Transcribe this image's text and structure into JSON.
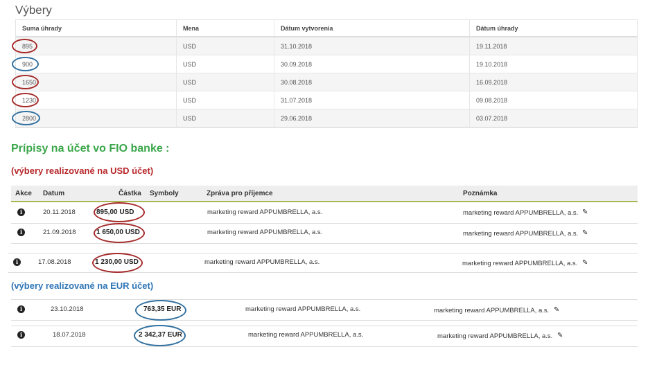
{
  "vybery": {
    "title": "Výbery",
    "headers": [
      "Suma úhrady",
      "Mena",
      "Dátum vytvorenia",
      "Dátum úhrady"
    ],
    "rows": [
      [
        "895",
        "USD",
        "31.10.2018",
        "19.11.2018"
      ],
      [
        "900",
        "USD",
        "30.09.2018",
        "19.10.2018"
      ],
      [
        "1650",
        "USD",
        "30.08.2018",
        "16.09.2018"
      ],
      [
        "1230",
        "USD",
        "31.07.2018",
        "09.08.2018"
      ],
      [
        "2800",
        "USD",
        "29.06.2018",
        "03.07.2018"
      ]
    ],
    "circle_colors": [
      "red",
      "blue",
      "red",
      "red",
      "blue"
    ]
  },
  "fio": {
    "heading": "Prípisy na účet vo FIO banke :",
    "usd_subtitle": "(výbery realizované na USD účet)",
    "eur_subtitle": "(výbery realizované na EUR účet)",
    "headers": {
      "akce": "Akce",
      "datum": "Datum",
      "castka": "Částka",
      "symboly": "Symboly",
      "zprava": "Zpráva pro příjemce",
      "poznamka": "Poznámka"
    },
    "usd_rows": [
      {
        "date": "20.11.2018",
        "amount": "895,00 USD",
        "message": "marketing reward APPUMBRELLA, a.s.",
        "note": "marketing reward APPUMBRELLA, a.s."
      },
      {
        "date": "21.09.2018",
        "amount": "1 650,00 USD",
        "message": "marketing reward APPUMBRELLA, a.s.",
        "note": "marketing reward APPUMBRELLA, a.s."
      },
      {
        "date": "17.08.2018",
        "amount": "1 230,00 USD",
        "message": "marketing reward APPUMBRELLA, a.s.",
        "note": "marketing reward APPUMBRELLA, a.s."
      }
    ],
    "eur_rows": [
      {
        "date": "23.10.2018",
        "amount": "763,35 EUR",
        "message": "marketing reward APPUMBRELLA, a.s.",
        "note": "marketing reward APPUMBRELLA, a.s."
      },
      {
        "date": "18.07.2018",
        "amount": "2 342,37 EUR",
        "message": "marketing reward APPUMBRELLA, a.s.",
        "note": "marketing reward APPUMBRELLA, a.s."
      }
    ]
  },
  "colors": {
    "red": "#b8282b",
    "blue": "#2e75b6",
    "green": "#3aa64a"
  }
}
